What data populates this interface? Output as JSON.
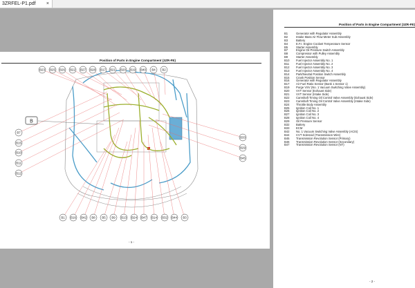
{
  "tab": {
    "title": "3ZRFEL-P1.pdf",
    "close": "×"
  },
  "page1": {
    "title": "Position of Parts in Engine Compartment (3ZR-FE)",
    "group_label": "B",
    "top_labels": [
      "B23",
      "B25",
      "B26",
      "B22",
      "B27",
      "B28",
      "B17",
      "B21",
      "B20",
      "B19",
      "B40",
      "B4",
      "B2"
    ],
    "left_labels": [
      "B7",
      "B15",
      "B10",
      "B11",
      "B12"
    ],
    "right_labels": [
      "B33",
      "B29",
      "B45"
    ],
    "bottom_labels": [
      "B1",
      "B16",
      "B42",
      "B8",
      "B5",
      "B9",
      "B13",
      "B24",
      "B47",
      "B14",
      "B32",
      "B44",
      "B3"
    ],
    "page_number": "- 1 -"
  },
  "page2": {
    "title": "Position of Parts in Engine Compartment (3ZR-FE)",
    "items": [
      {
        "code": "B1",
        "name": "Generator with Regulator Assembly"
      },
      {
        "code": "B2",
        "name": "Intake Mass Air Flow Meter Sub-Assembly"
      },
      {
        "code": "B3",
        "name": "Battery"
      },
      {
        "code": "B4",
        "name": "E.F.I. Engine Coolant Temperature Sensor"
      },
      {
        "code": "B5",
        "name": "Starter Assembly"
      },
      {
        "code": "B7",
        "name": "Engine Oil Pressure Switch Assembly"
      },
      {
        "code": "B8",
        "name": "Compressor with Pulley Assembly"
      },
      {
        "code": "B9",
        "name": "Starter Assembly"
      },
      {
        "code": "B10",
        "name": "Fuel Injector Assembly No. 1"
      },
      {
        "code": "B11",
        "name": "Fuel Injector Assembly No. 2"
      },
      {
        "code": "B12",
        "name": "Fuel Injector Assembly No. 3"
      },
      {
        "code": "B13",
        "name": "Fuel Injector Assembly No. 4"
      },
      {
        "code": "B14",
        "name": "Park/Neutral Position Switch Assembly"
      },
      {
        "code": "B15",
        "name": "Crank Position Sensor"
      },
      {
        "code": "B16",
        "name": "Generator with Regulator Assembly"
      },
      {
        "code": "B17",
        "name": "Air Fuel Ratio Sensor (Bank 1 Sensor 1)"
      },
      {
        "code": "B19",
        "name": "Purge VSV (No. 1 Vacuum Switching Valve Assembly)"
      },
      {
        "code": "B20",
        "name": "VVT Sensor (Exhaust Side)"
      },
      {
        "code": "B21",
        "name": "VVT Sensor (Intake Side)"
      },
      {
        "code": "B22",
        "name": "Camshaft Timing Oil Control Valve Assembly (Exhaust Side)"
      },
      {
        "code": "B23",
        "name": "Camshaft Timing Oil Control Valve Assembly (Intake Side)"
      },
      {
        "code": "B24",
        "name": "Throttle Body Assembly"
      },
      {
        "code": "B25",
        "name": "Ignition Coil No. 1"
      },
      {
        "code": "B26",
        "name": "Ignition Coil No. 2"
      },
      {
        "code": "B27",
        "name": "Ignition Coil No. 3"
      },
      {
        "code": "B28",
        "name": "Ignition Coil No. 4"
      },
      {
        "code": "B29",
        "name": "Oil Pressure Sensor"
      },
      {
        "code": "B32",
        "name": "Battery"
      },
      {
        "code": "B33",
        "name": "ECM"
      },
      {
        "code": "B42",
        "name": "No. 1 Vacuum Switching Valve Assembly (ACIS)"
      },
      {
        "code": "B44",
        "name": "CVT Solenoid (Transmission Wire)"
      },
      {
        "code": "B45",
        "name": "Transmission Revolution Sensor (Primary)"
      },
      {
        "code": "B46",
        "name": "Transmission Revolution Sensor (Secondary)"
      },
      {
        "code": "B47",
        "name": "Transmission Revolution Sensor (NT)"
      }
    ],
    "page_number": "- 2 -"
  },
  "colors": {
    "background": "#a9a9a9",
    "leader": "#e86a6a",
    "harness_blue": "#4a9cc8",
    "harness_green": "#9aae2a"
  }
}
